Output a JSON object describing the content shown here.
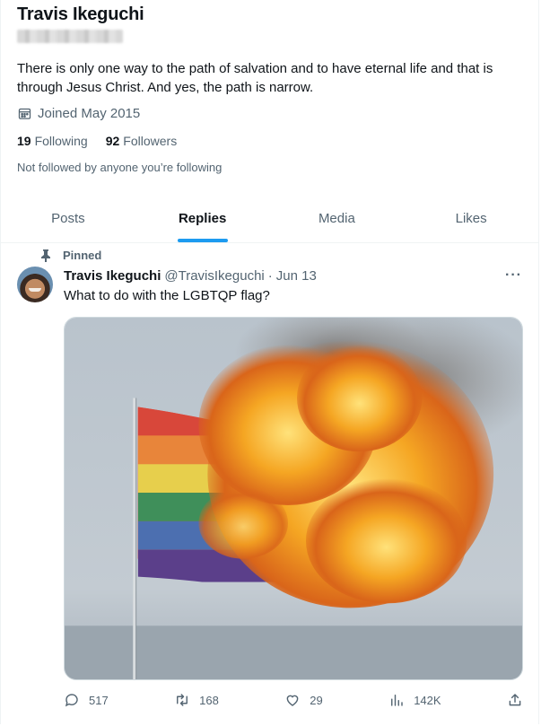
{
  "profile": {
    "name": "Travis Ikeguchi",
    "bio": "There is only one way to the path of salvation and to have eternal life and that is through Jesus Christ. And yes, the path is narrow.",
    "joined": "Joined May 2015",
    "following_count": "19",
    "following_label": "Following",
    "followers_count": "92",
    "followers_label": "Followers",
    "not_followed": "Not followed by anyone you’re following"
  },
  "tabs": [
    {
      "label": "Posts"
    },
    {
      "label": "Replies",
      "active": true
    },
    {
      "label": "Media"
    },
    {
      "label": "Likes"
    }
  ],
  "tweet": {
    "pinned_label": "Pinned",
    "author": "Travis Ikeguchi",
    "handle": "@TravisIkeguchi",
    "separator": "·",
    "date": "Jun 13",
    "text": "What to do with the LGBTQP flag?",
    "more_label": "···",
    "actions": {
      "replies": "517",
      "reposts": "168",
      "likes": "29",
      "views": "142K"
    }
  },
  "colors": {
    "accent": "#1d9bf0",
    "secondary_text": "#536471"
  }
}
